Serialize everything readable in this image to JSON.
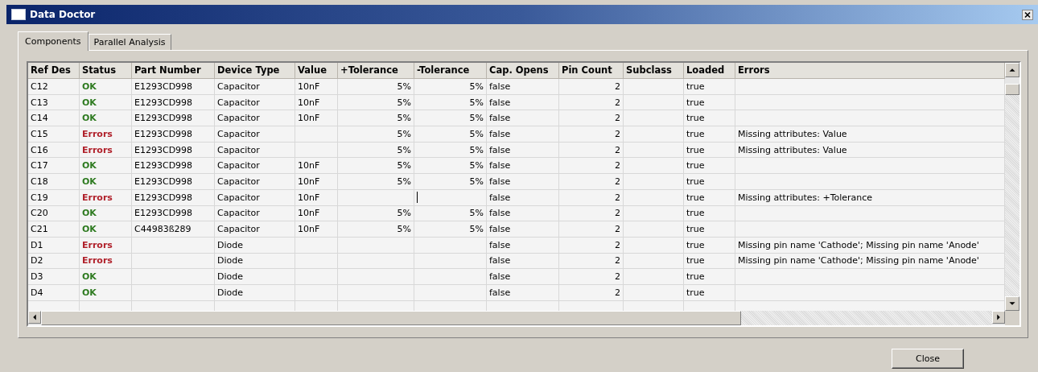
{
  "window": {
    "title": "Data Doctor"
  },
  "tabs": [
    {
      "label": "Components",
      "selected": true
    },
    {
      "label": "Parallel Analysis",
      "selected": false
    }
  ],
  "table": {
    "columns": [
      "Ref Des",
      "Status",
      "Part Number",
      "Device Type",
      "Value",
      "+Tolerance",
      "-Tolerance",
      "Cap. Opens",
      "Pin Count",
      "Subclass",
      "Loaded",
      "Errors"
    ],
    "rows": [
      {
        "ref": "C12",
        "status": {
          "text": "OK",
          "kind": "ok"
        },
        "part": "E1293CD998",
        "type": "Capacitor",
        "value": "10nF",
        "plus_tol": "5%",
        "minus_tol": "5%",
        "cap_opens": "false",
        "pins": "2",
        "subclass": "",
        "loaded": "true",
        "errors": "",
        "editing": false
      },
      {
        "ref": "C13",
        "status": {
          "text": "OK",
          "kind": "ok"
        },
        "part": "E1293CD998",
        "type": "Capacitor",
        "value": "10nF",
        "plus_tol": "5%",
        "minus_tol": "5%",
        "cap_opens": "false",
        "pins": "2",
        "subclass": "",
        "loaded": "true",
        "errors": "",
        "editing": false
      },
      {
        "ref": "C14",
        "status": {
          "text": "OK",
          "kind": "ok"
        },
        "part": "E1293CD998",
        "type": "Capacitor",
        "value": "10nF",
        "plus_tol": "5%",
        "minus_tol": "5%",
        "cap_opens": "false",
        "pins": "2",
        "subclass": "",
        "loaded": "true",
        "errors": "",
        "editing": false
      },
      {
        "ref": "C15",
        "status": {
          "text": "Errors",
          "kind": "error"
        },
        "part": "E1293CD998",
        "type": "Capacitor",
        "value": "",
        "plus_tol": "5%",
        "minus_tol": "5%",
        "cap_opens": "false",
        "pins": "2",
        "subclass": "",
        "loaded": "true",
        "errors": "Missing attributes: Value",
        "editing": false
      },
      {
        "ref": "C16",
        "status": {
          "text": "Errors",
          "kind": "error"
        },
        "part": "E1293CD998",
        "type": "Capacitor",
        "value": "",
        "plus_tol": "5%",
        "minus_tol": "5%",
        "cap_opens": "false",
        "pins": "2",
        "subclass": "",
        "loaded": "true",
        "errors": "Missing attributes: Value",
        "editing": false
      },
      {
        "ref": "C17",
        "status": {
          "text": "OK",
          "kind": "ok"
        },
        "part": "E1293CD998",
        "type": "Capacitor",
        "value": "10nF",
        "plus_tol": "5%",
        "minus_tol": "5%",
        "cap_opens": "false",
        "pins": "2",
        "subclass": "",
        "loaded": "true",
        "errors": "",
        "editing": false
      },
      {
        "ref": "C18",
        "status": {
          "text": "OK",
          "kind": "ok"
        },
        "part": "E1293CD998",
        "type": "Capacitor",
        "value": "10nF",
        "plus_tol": "5%",
        "minus_tol": "5%",
        "cap_opens": "false",
        "pins": "2",
        "subclass": "",
        "loaded": "true",
        "errors": "",
        "editing": false
      },
      {
        "ref": "C19",
        "status": {
          "text": "Errors",
          "kind": "error"
        },
        "part": "E1293CD998",
        "type": "Capacitor",
        "value": "10nF",
        "plus_tol": "",
        "minus_tol": "",
        "cap_opens": "false",
        "pins": "2",
        "subclass": "",
        "loaded": "true",
        "errors": "Missing attributes: +Tolerance",
        "editing": true
      },
      {
        "ref": "C20",
        "status": {
          "text": "OK",
          "kind": "ok"
        },
        "part": "E1293CD998",
        "type": "Capacitor",
        "value": "10nF",
        "plus_tol": "5%",
        "minus_tol": "5%",
        "cap_opens": "false",
        "pins": "2",
        "subclass": "",
        "loaded": "true",
        "errors": "",
        "editing": false
      },
      {
        "ref": "C21",
        "status": {
          "text": "OK",
          "kind": "ok"
        },
        "part": "C44983ß289",
        "type": "Capacitor",
        "value": "10nF",
        "plus_tol": "5%",
        "minus_tol": "5%",
        "cap_opens": "false",
        "pins": "2",
        "subclass": "",
        "loaded": "true",
        "errors": "",
        "editing": false
      },
      {
        "ref": "D1",
        "status": {
          "text": "Errors",
          "kind": "error"
        },
        "part": "",
        "type": "Diode",
        "value": "",
        "plus_tol": "",
        "minus_tol": "",
        "cap_opens": "false",
        "pins": "2",
        "subclass": "",
        "loaded": "true",
        "errors": "Missing pin name 'Cathode'; Missing pin name 'Anode'",
        "editing": false
      },
      {
        "ref": "D2",
        "status": {
          "text": "Errors",
          "kind": "error"
        },
        "part": "",
        "type": "Diode",
        "value": "",
        "plus_tol": "",
        "minus_tol": "",
        "cap_opens": "false",
        "pins": "2",
        "subclass": "",
        "loaded": "true",
        "errors": "Missing pin name 'Cathode'; Missing pin name 'Anode'",
        "editing": false
      },
      {
        "ref": "D3",
        "status": {
          "text": "OK",
          "kind": "ok"
        },
        "part": "",
        "type": "Diode",
        "value": "",
        "plus_tol": "",
        "minus_tol": "",
        "cap_opens": "false",
        "pins": "2",
        "subclass": "",
        "loaded": "true",
        "errors": "",
        "editing": false
      },
      {
        "ref": "D4",
        "status": {
          "text": "OK",
          "kind": "ok"
        },
        "part": "",
        "type": "Diode",
        "value": "",
        "plus_tol": "",
        "minus_tol": "",
        "cap_opens": "false",
        "pins": "2",
        "subclass": "",
        "loaded": "true",
        "errors": "",
        "editing": false
      }
    ]
  },
  "buttons": [
    {
      "label": "Close"
    }
  ]
}
